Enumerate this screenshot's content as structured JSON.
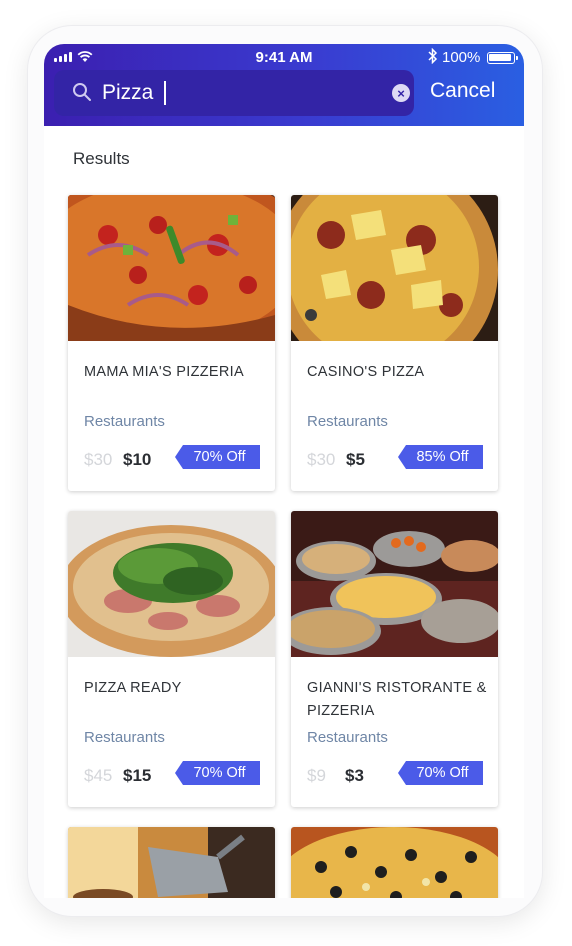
{
  "status_bar": {
    "time": "9:41 AM",
    "battery": "100%"
  },
  "search": {
    "value": "Pizza",
    "cancel_label": "Cancel"
  },
  "results": {
    "title": "Results",
    "cards": [
      {
        "name": "MAMA MIA'S PIZZERIA",
        "category": "Restaurants",
        "old_price": "$30",
        "new_price": "$10",
        "discount": "70% Off"
      },
      {
        "name": "CASINO'S PIZZA",
        "category": "Restaurants",
        "old_price": "$30",
        "new_price": "$5",
        "discount": "85% Off"
      },
      {
        "name": "PIZZA READY",
        "category": "Restaurants",
        "old_price": "$45",
        "new_price": "$15",
        "discount": "70% Off"
      },
      {
        "name": "GIANNI'S RISTORANTE & PIZZERIA",
        "category": "Restaurants",
        "old_price": "$9",
        "new_price": "$3",
        "discount": "70% Off"
      }
    ]
  },
  "colors": {
    "header_start": "#3b1fb0",
    "header_end": "#2a5fe2",
    "badge": "#4b5be8",
    "category": "#6f86a6"
  },
  "icons": [
    "signal-icon",
    "wifi-icon",
    "bluetooth-icon",
    "battery-icon",
    "search-icon",
    "clear-icon"
  ]
}
